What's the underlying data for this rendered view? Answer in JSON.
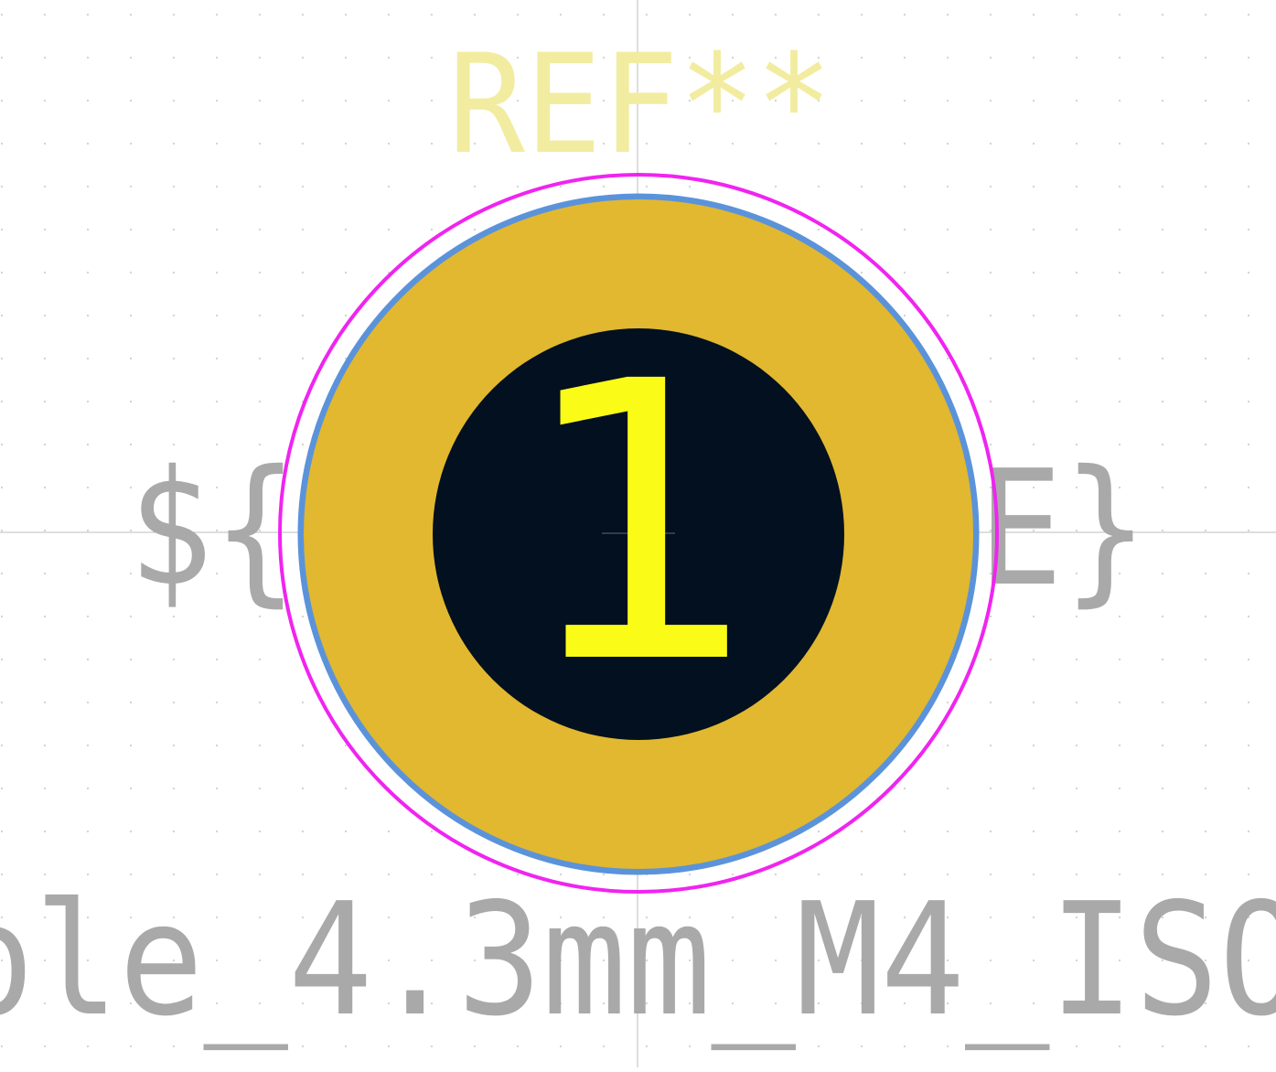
{
  "footprint": {
    "reference": "REF**",
    "value_text": "${REFERENCE}",
    "footprint_name_visible": "ole_4.3mm_M4_ISO",
    "pad_number": "1"
  },
  "colors": {
    "background": "#ffffff",
    "grid": "#c8c8c8",
    "crosshair": "#b4b4b4",
    "reference_text": "#f2eca0",
    "fab_text": "#a9a9a9",
    "courtyard": "#f024f0",
    "pad_outline": "#5b93db",
    "pad_copper": "#e1b82f",
    "drill_hole": "#02101f",
    "pad_number": "#fbfb18"
  }
}
